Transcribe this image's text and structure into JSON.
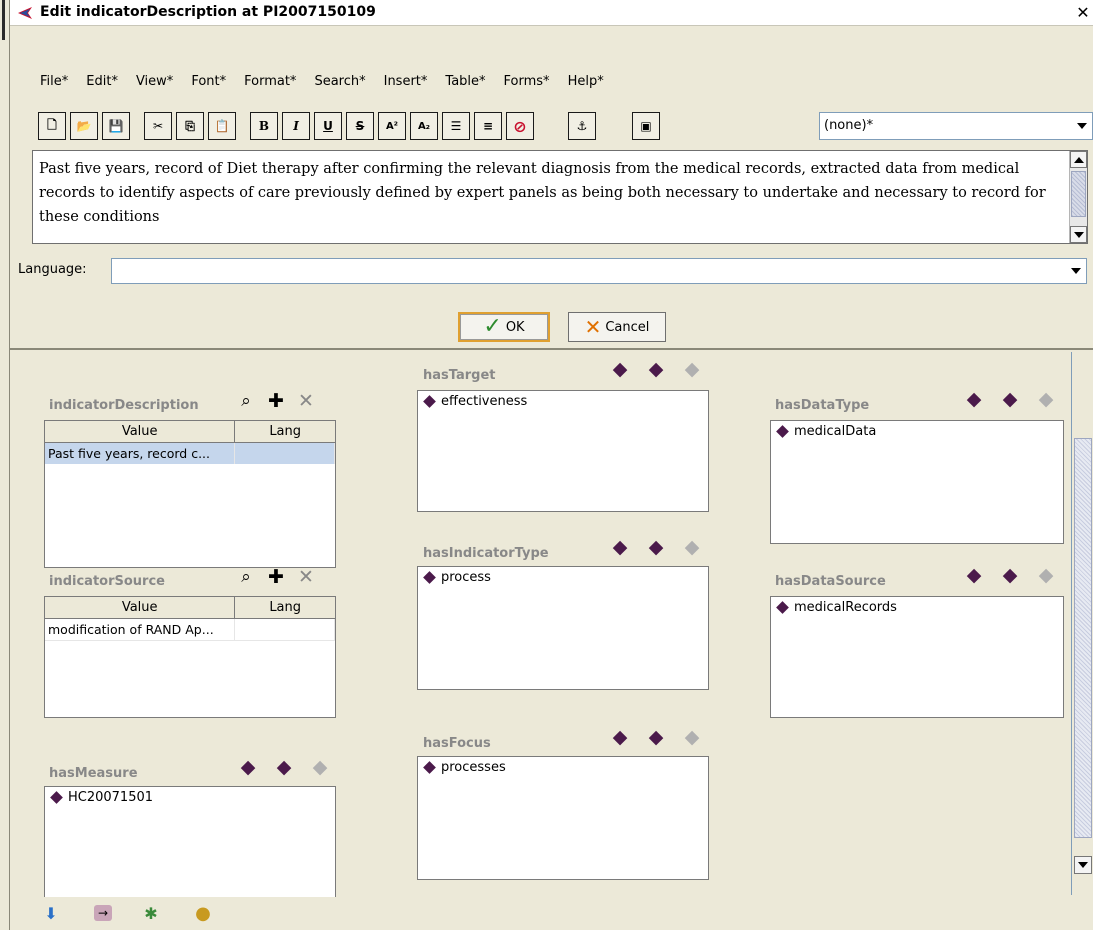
{
  "window": {
    "title": "Edit indicatorDescription at PI2007150109",
    "close_glyph": "✕"
  },
  "menu": [
    "File*",
    "Edit*",
    "View*",
    "Font*",
    "Format*",
    "Search*",
    "Insert*",
    "Table*",
    "Forms*",
    "Help*"
  ],
  "toolbar": {
    "buttons": [
      {
        "name": "new-document-icon",
        "glyph": "🗋"
      },
      {
        "name": "open-folder-icon",
        "glyph": "📂"
      },
      {
        "name": "save-icon",
        "glyph": "💾"
      },
      {
        "name": "cut-icon",
        "glyph": "✂"
      },
      {
        "name": "copy-icon",
        "glyph": "⎘"
      },
      {
        "name": "paste-icon",
        "glyph": "📋"
      },
      {
        "name": "bold-icon",
        "glyph": "B"
      },
      {
        "name": "italic-icon",
        "glyph": "I"
      },
      {
        "name": "underline-icon",
        "glyph": "U"
      },
      {
        "name": "strikethrough-icon",
        "glyph": "S"
      },
      {
        "name": "superscript-icon",
        "glyph": "A²"
      },
      {
        "name": "subscript-icon",
        "glyph": "A₂"
      },
      {
        "name": "bullet-list-icon",
        "glyph": "☰"
      },
      {
        "name": "numbered-list-icon",
        "glyph": "≡"
      },
      {
        "name": "clear-format-icon",
        "glyph": "⊘"
      },
      {
        "name": "anchor-icon",
        "glyph": "⚓"
      },
      {
        "name": "source-view-icon",
        "glyph": "▣"
      }
    ],
    "style_value": "(none)*"
  },
  "editor": {
    "text": "Past five years, record of Diet therapy after confirming the relevant diagnosis from the medical records, extracted data from medical records to identify aspects of care previously defined by expert panels as being both necessary to undertake and necessary to record for these conditions"
  },
  "language": {
    "label": "Language:",
    "value": ""
  },
  "buttons": {
    "ok": "OK",
    "cancel": "Cancel"
  },
  "form": {
    "indicatorDescription": {
      "label": "indicatorDescription",
      "columns": [
        "Value",
        "Lang"
      ],
      "rows": [
        [
          "Past five years, record c...",
          ""
        ]
      ]
    },
    "indicatorSource": {
      "label": "indicatorSource",
      "columns": [
        "Value",
        "Lang"
      ],
      "rows": [
        [
          "modification of RAND Ap...",
          ""
        ]
      ]
    },
    "hasMeasure": {
      "label": "hasMeasure",
      "items": [
        "HC20071501"
      ]
    },
    "hasTarget": {
      "label": "hasTarget",
      "items": [
        "effectiveness"
      ]
    },
    "hasIndicatorType": {
      "label": "hasIndicatorType",
      "items": [
        "process"
      ]
    },
    "hasFocus": {
      "label": "hasFocus",
      "items": [
        "processes"
      ]
    },
    "hasDataType": {
      "label": "hasDataType",
      "items": [
        "medicalData"
      ]
    },
    "hasDataSource": {
      "label": "hasDataSource",
      "items": [
        "medicalRecords"
      ]
    }
  },
  "colors": {
    "accent": "#4b1a4b",
    "label_gray": "#888888",
    "ok_border": "#e0a030"
  }
}
